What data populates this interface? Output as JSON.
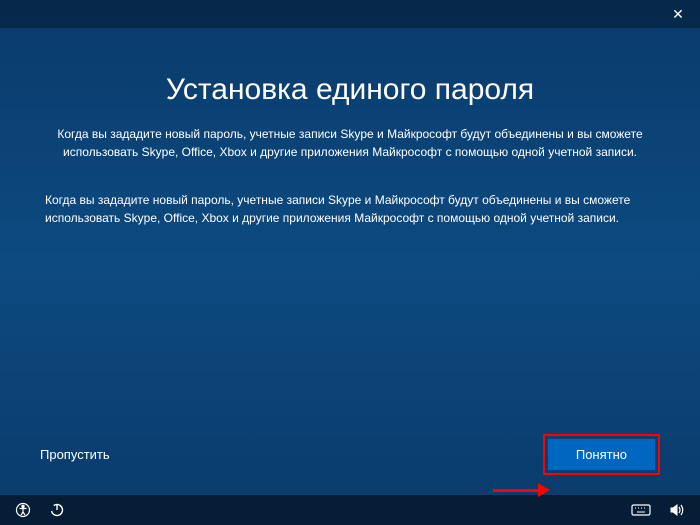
{
  "heading": "Установка единого пароля",
  "subtitle": "Когда вы зададите новый пароль, учетные записи Skype и Майкрософт будут объединены и вы сможете использовать Skype, Office, Xbox и другие приложения Майкрософт с помощью одной учетной записи.",
  "body": "Когда вы зададите новый пароль, учетные записи Skype и Майкрософт будут объединены и вы сможете использовать Skype, Office, Xbox и другие приложения Майкрософт с помощью одной учетной записи.",
  "skip_label": "Пропустить",
  "primary_label": "Понятно",
  "icons": {
    "close": "✕"
  }
}
